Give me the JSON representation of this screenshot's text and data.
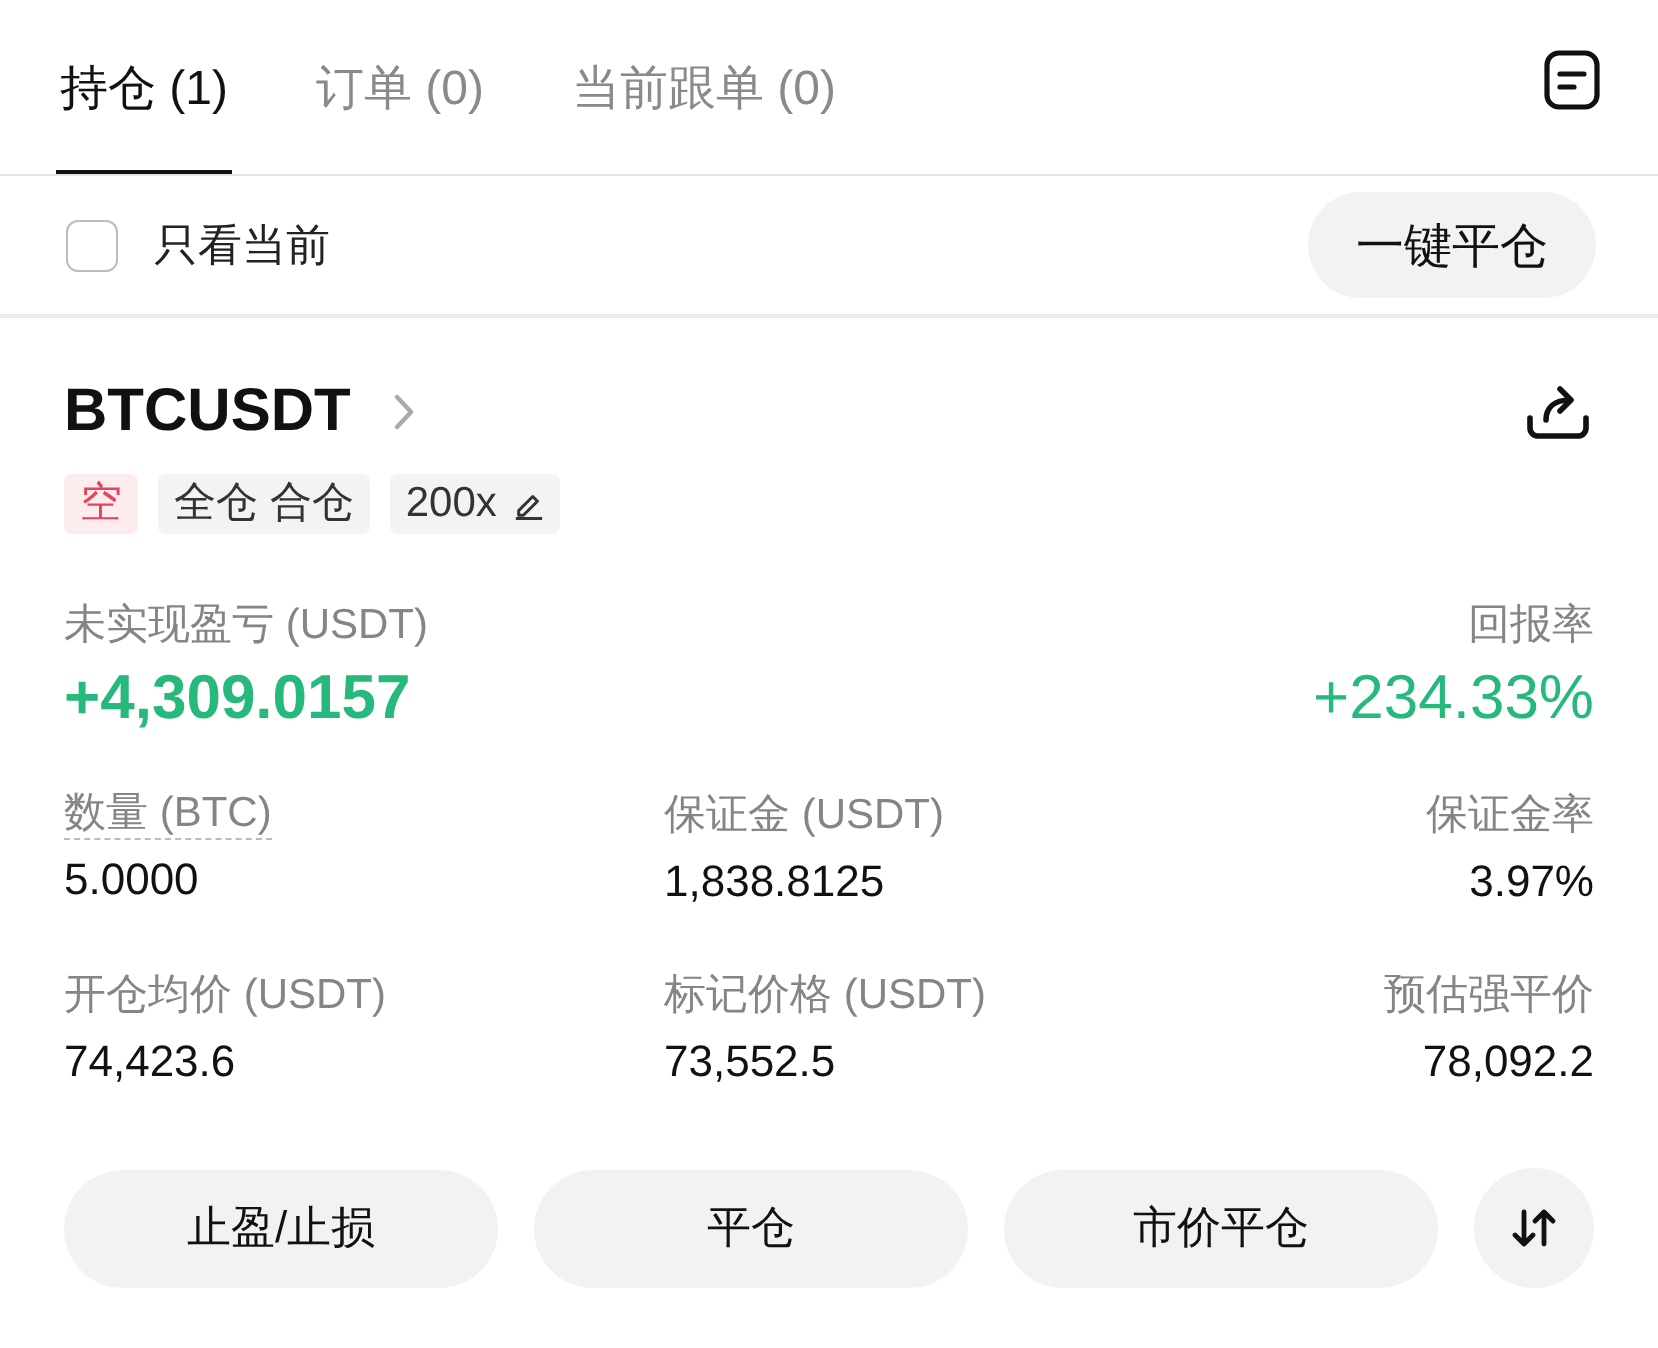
{
  "tabs": [
    {
      "label": "持仓 (1)",
      "selected": true
    },
    {
      "label": "订单 (0)",
      "selected": false
    },
    {
      "label": "当前跟单 (0)",
      "selected": false
    }
  ],
  "filter": {
    "label": "只看当前",
    "checked": false
  },
  "close_all_button": "一键平仓",
  "position": {
    "symbol": "BTCUSDT",
    "tags": [
      {
        "kind": "side",
        "label": "空"
      },
      {
        "kind": "margin",
        "label": "全仓 合仓"
      },
      {
        "kind": "leverage",
        "label": "200x"
      }
    ],
    "pnl": {
      "label": "未实现盈亏 (USDT)",
      "value": "+4,309.0157",
      "positive": true
    },
    "roi": {
      "label": "回报率",
      "value": "+234.33%",
      "positive": true
    },
    "fields": [
      {
        "label": "数量 (BTC)",
        "value": "5.0000",
        "underlined": true
      },
      {
        "label": "保证金 (USDT)",
        "value": "1,838.8125",
        "underlined": false
      },
      {
        "label": "保证金率",
        "value": "3.97%",
        "underlined": false
      },
      {
        "label": "开仓均价 (USDT)",
        "value": "74,423.6",
        "underlined": false
      },
      {
        "label": "标记价格 (USDT)",
        "value": "73,552.5",
        "underlined": false
      },
      {
        "label": "预估强平价",
        "value": "78,092.2",
        "underlined": false
      }
    ],
    "actions": [
      "止盈/止损",
      "平仓",
      "市价平仓"
    ]
  }
}
